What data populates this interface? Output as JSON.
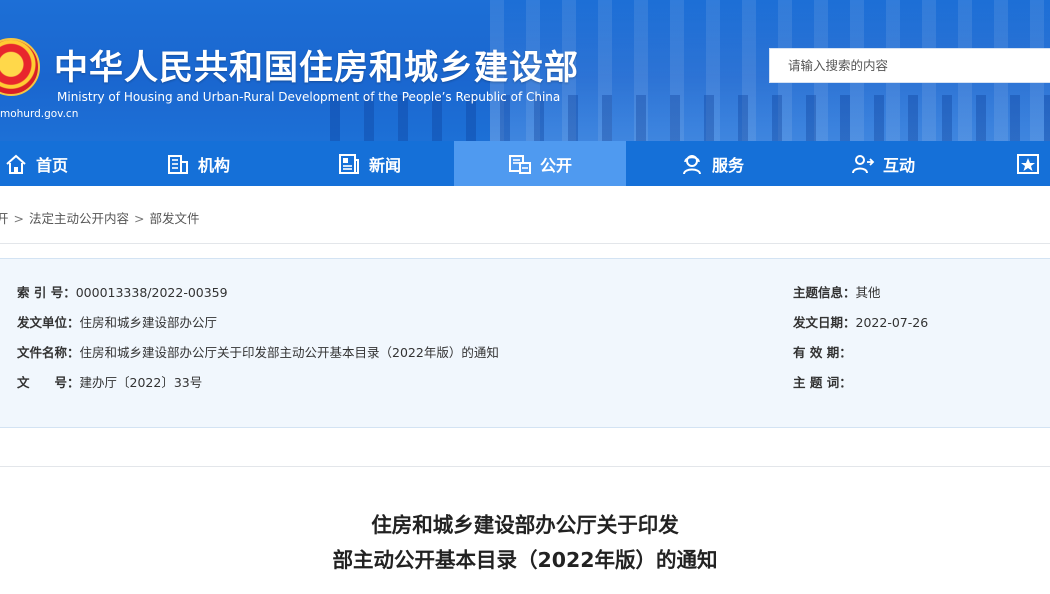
{
  "header": {
    "title": "中华人民共和国住房和城乡建设部",
    "subtitle": "Ministry of Housing and Urban-Rural Development of the People’s Republic of China",
    "domain": "mohurd.gov.cn",
    "emblem": "national-emblem",
    "search_placeholder": "请输入搜索的内容"
  },
  "nav": {
    "items": [
      {
        "label": "首页",
        "icon": "home-icon"
      },
      {
        "label": "机构",
        "icon": "building-icon"
      },
      {
        "label": "新闻",
        "icon": "news-icon"
      },
      {
        "label": "公开",
        "icon": "document-icon",
        "active": true
      },
      {
        "label": "服务",
        "icon": "service-icon"
      },
      {
        "label": "互动",
        "icon": "user-interaction-icon"
      },
      {
        "label": "",
        "icon": "star-icon"
      }
    ]
  },
  "breadcrumb": {
    "items": [
      "开",
      "法定主动公开内容",
      "部发文件"
    ],
    "separator": ">"
  },
  "meta": {
    "index_label": "索 引 号：",
    "index_value": "000013338/2022-00359",
    "issuer_label": "发文单位：",
    "issuer_value": "住房和城乡建设部办公厅",
    "filename_label": "文件名称：",
    "filename_value": "住房和城乡建设部办公厅关于印发部主动公开基本目录（2022年版）的通知",
    "docno_label": "文　　号：",
    "docno_value": "建办厅〔2022〕33号",
    "topic_label": "主题信息：",
    "topic_value": "其他",
    "date_label": "发文日期：",
    "date_value": "2022-07-26",
    "validity_label": "有 效 期：",
    "validity_value": "",
    "keywords_label": "主 题 词：",
    "keywords_value": ""
  },
  "article": {
    "title_line1": "住房和城乡建设部办公厅关于印发",
    "title_line2": "部主动公开基本目录（2022年版）的通知"
  },
  "colors": {
    "header_blue": "#1a66cf",
    "nav_blue": "#1570d8",
    "nav_active": "#4f9af0",
    "meta_bg": "#f1f7fd"
  }
}
